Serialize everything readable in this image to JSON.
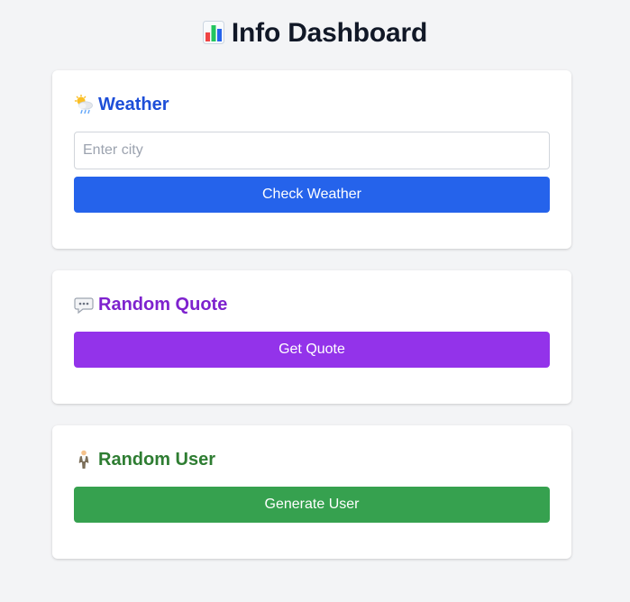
{
  "header": {
    "title": "Info Dashboard",
    "icon": "bar-chart-icon"
  },
  "weather": {
    "heading": "Weather",
    "icon": "sun-behind-rain-cloud-icon",
    "input_placeholder": "Enter city",
    "input_value": "",
    "button_label": "Check Weather",
    "heading_color": "#1d4ed8",
    "button_color": "#2563eb"
  },
  "quote": {
    "heading": "Random Quote",
    "icon": "speech-balloon-icon",
    "button_label": "Get Quote",
    "heading_color": "#7e22ce",
    "button_color": "#9333ea"
  },
  "user": {
    "heading": "Random User",
    "icon": "person-standing-icon",
    "button_label": "Generate User",
    "heading_color": "#2e7d32",
    "button_color": "#36a14f"
  }
}
